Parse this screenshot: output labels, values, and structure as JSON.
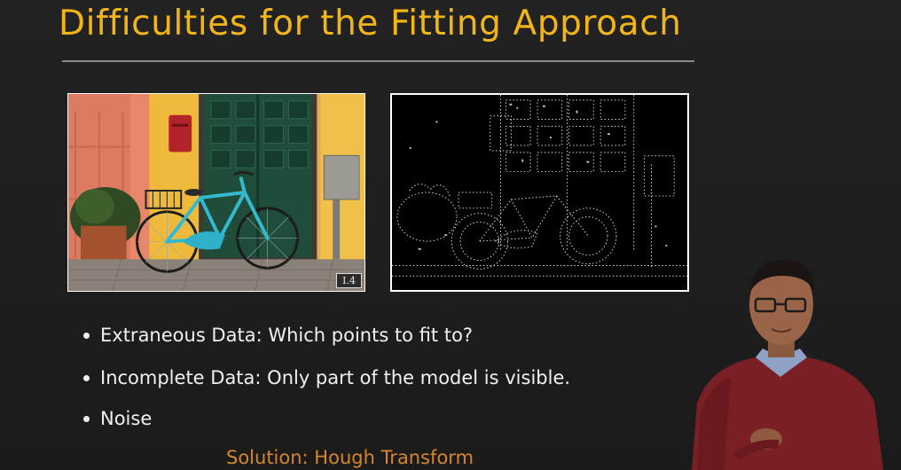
{
  "slide": {
    "title": "Difficulties for the Fitting Approach",
    "figure_tag": "I.4",
    "bullets": [
      "Extraneous Data: Which points to fit to?",
      "Incomplete Data: Only part of the model is visible.",
      "Noise"
    ],
    "solution": "Solution: Hough Transform"
  },
  "colors": {
    "background": "#1f1f1f",
    "title": "#f2b514",
    "bullet_text": "#f0f0f0",
    "solution_text": "#d7852a",
    "rule": "#8a8a8a"
  },
  "icons": {
    "bullet": "filled-circle"
  }
}
